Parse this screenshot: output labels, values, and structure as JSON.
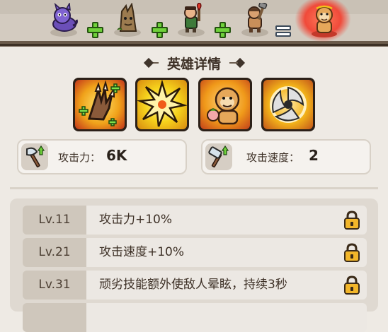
{
  "formula": {
    "items": [
      {
        "name": "purple-beast",
        "icon": "purple-dragon-hero-icon"
      },
      {
        "name": "tree-stump",
        "icon": "tree-stump-hero-icon"
      },
      {
        "name": "torch-soldier",
        "icon": "torch-soldier-hero-icon"
      },
      {
        "name": "caveman",
        "icon": "caveman-hero-icon"
      }
    ],
    "result_icon": "monkey-king-hero-icon",
    "operator_plus": "plus-icon",
    "operator_equals": "equals-icon"
  },
  "section_title": "英雄详情",
  "skills": [
    {
      "icon": "claw-skill-icon",
      "frame_color": "#f2b21a"
    },
    {
      "icon": "explosion-skill-icon",
      "frame_color": "#f6d21c"
    },
    {
      "icon": "monkey-summon-skill-icon",
      "frame_color": "#f2a01a"
    },
    {
      "icon": "spinning-blade-skill-icon",
      "frame_color": "#f2b21a"
    }
  ],
  "stats": [
    {
      "icon": "axe-upgrade-icon",
      "label": "攻击力：",
      "value": "6K"
    },
    {
      "icon": "hammer-speed-upgrade-icon",
      "label": "攻击速度：",
      "value": "2"
    }
  ],
  "levels": [
    {
      "level": "Lv.11",
      "text": "攻击力+10%",
      "locked": true
    },
    {
      "level": "Lv.21",
      "text": "攻击速度+10%",
      "locked": true
    },
    {
      "level": "Lv.31",
      "text": "顽劣技能额外使敌人晕眩，持续3秒",
      "locked": true
    }
  ],
  "colors": {
    "background": "#eeeae4",
    "plus_green": "#6fd13a",
    "result_glow": "#f04a3a",
    "lock_gold": "#f2b62a"
  }
}
